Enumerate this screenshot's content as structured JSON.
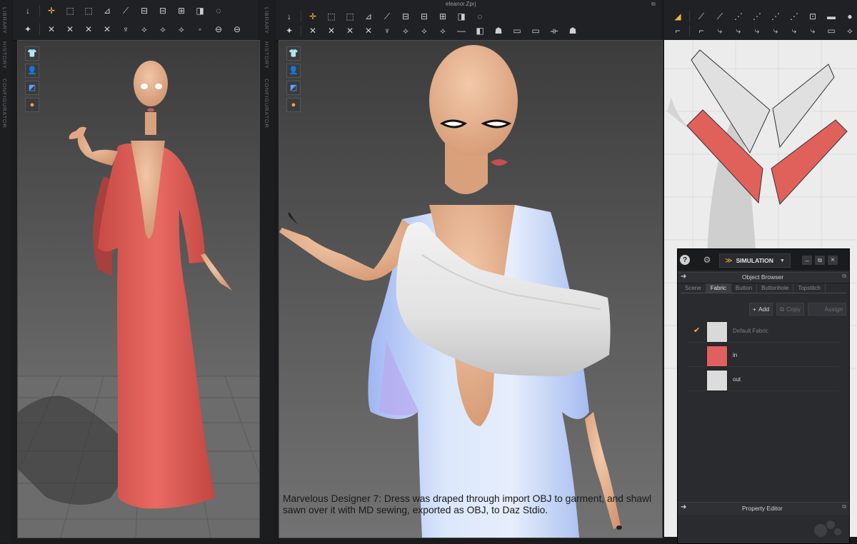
{
  "window": {
    "title": "eleanor.Zprj"
  },
  "left_sidebar": {
    "tabs": [
      "LIBRARY",
      "HISTORY",
      "CONFIGURATOR"
    ]
  },
  "mid_sidebar": {
    "tabs": [
      "LIBRARY",
      "HISTORY",
      "CONFIGURATOR"
    ]
  },
  "icons": {
    "toolbar_left_row1": [
      "↓",
      "✛",
      "⬚",
      "⬚",
      "⊿",
      "⟋",
      "⊟",
      "⊟",
      "⊞",
      "◨",
      "◌"
    ],
    "toolbar_left_row2": [
      "✦",
      "✕",
      "✕",
      "✕",
      "✕",
      "♆",
      "⟡",
      "⟡",
      "⟡",
      "◦",
      "⊖",
      "⊖"
    ],
    "toolbar_mid_row1": [
      "↓",
      "✛",
      "⬚",
      "⬚",
      "⊿",
      "⟋",
      "⊟",
      "⊟",
      "⊞",
      "◨",
      "◌"
    ],
    "toolbar_mid_row2": [
      "✦",
      "✕",
      "✕",
      "✕",
      "✕",
      "♆",
      "⟡",
      "⟡",
      "⟡",
      "—",
      "◧",
      "☗",
      "▭",
      "▭",
      "⟛",
      "☗"
    ],
    "toolbar_right_row1": [
      "◢",
      "⟋",
      "⟋",
      "⋰",
      "⋰",
      "⋰",
      "⋰",
      "⊡",
      "▬",
      "●",
      "▮",
      "▮"
    ],
    "toolbar_right_row2": [
      "⌐",
      "⌐",
      "⤷",
      "⤷",
      "⤷",
      "⤷",
      "⤷",
      "⤷",
      "▭",
      "⟡",
      "⟡",
      "⟡"
    ],
    "viewport_tools": [
      "shirt-icon",
      "avatar-icon",
      "texture-icon",
      "head-icon"
    ]
  },
  "panel": {
    "help": "?",
    "mode_icon": "gear",
    "mode_label": "SIMULATION",
    "minimize": "–",
    "restore": "⧉",
    "close": "×",
    "object_browser": "Object Browser",
    "tabs": [
      "Scene",
      "Fabric",
      "Button",
      "Buttonhole",
      "Topstitch"
    ],
    "active_tab": "Fabric",
    "actions": {
      "add": "Add",
      "copy": "Copy",
      "assign": "Assign"
    },
    "fabrics": [
      {
        "name": "Default Fabric",
        "color": "#d9d9d9",
        "checked": true
      },
      {
        "name": "in",
        "color": "#e0605f",
        "checked": false
      },
      {
        "name": "out",
        "color": "#dcdcdc",
        "checked": false
      }
    ],
    "property_editor": "Property Editor"
  },
  "caption": "Marvelous Designer 7: Dress was draped through import OBJ to garment, and shawl sawn over it with MD sewing, exported as OBJ, to Daz Stdio.",
  "colors": {
    "dress": "#e0605a",
    "dress_light": "#bcd3f6",
    "shawl": "#e8e8e8",
    "skin": "#e9b38f",
    "accent": "#f2b53a"
  }
}
